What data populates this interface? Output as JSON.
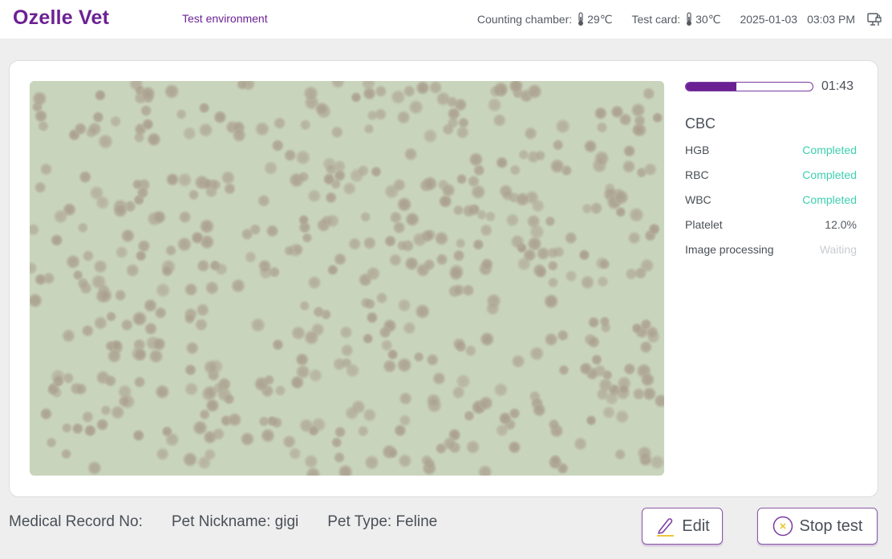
{
  "header": {
    "brand": "Ozelle Vet",
    "environment": "Test environment",
    "counting_chamber_label": "Counting chamber:",
    "counting_chamber_temp": "29℃",
    "test_card_label": "Test card:",
    "test_card_temp": "30℃",
    "date": "2025-01-03",
    "time": "03:03 PM",
    "icons": {
      "thermometer": "thermometer-icon",
      "network": "network-lock-icon"
    }
  },
  "test": {
    "progress_percent": 40,
    "remaining_time": "01:43",
    "section_title": "CBC",
    "items": [
      {
        "name": "HGB",
        "status": "Completed",
        "kind": "ok"
      },
      {
        "name": "RBC",
        "status": "Completed",
        "kind": "ok"
      },
      {
        "name": "WBC",
        "status": "Completed",
        "kind": "ok"
      },
      {
        "name": "Platelet",
        "status": "12.0%",
        "kind": "val"
      },
      {
        "name": "Image processing",
        "status": "Waiting",
        "kind": "wait"
      }
    ],
    "image_description": "Microscopy view of blood cells"
  },
  "footer": {
    "medical_record": "Medical Record No:",
    "pet_nickname": "Pet Nickname: gigi",
    "pet_type": "Pet Type: Feline"
  },
  "buttons": {
    "edit": "Edit",
    "stop": "Stop test"
  },
  "colors": {
    "brand": "#6b2193",
    "completed": "#3ecfb0",
    "waiting": "#c9ccd0",
    "accent_yellow": "#e8c93a"
  }
}
